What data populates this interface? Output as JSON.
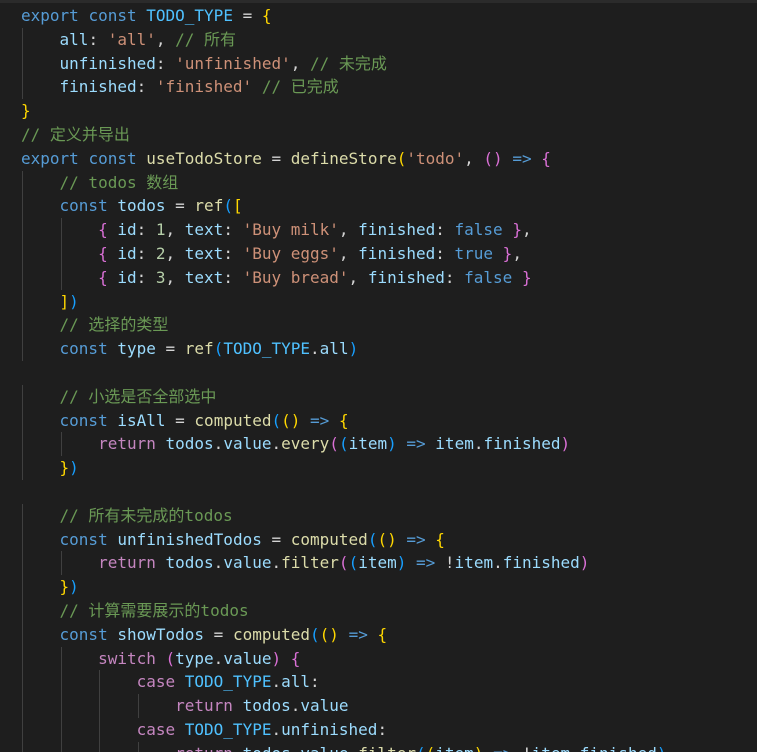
{
  "editor": {
    "language": "javascript",
    "lines": [
      [
        [
          "k",
          "export"
        ],
        [
          "op",
          " "
        ],
        [
          "k",
          "const"
        ],
        [
          "op",
          " "
        ],
        [
          "n",
          "TODO_TYPE"
        ],
        [
          "op",
          " = "
        ],
        [
          "b1",
          "{"
        ]
      ],
      [
        [
          "op",
          "    "
        ],
        [
          "v",
          "all"
        ],
        [
          "op",
          ": "
        ],
        [
          "s",
          "'all'"
        ],
        [
          "op",
          ", "
        ],
        [
          "cm",
          "// 所有"
        ]
      ],
      [
        [
          "op",
          "    "
        ],
        [
          "v",
          "unfinished"
        ],
        [
          "op",
          ": "
        ],
        [
          "s",
          "'unfinished'"
        ],
        [
          "op",
          ", "
        ],
        [
          "cm",
          "// 未完成"
        ]
      ],
      [
        [
          "op",
          "    "
        ],
        [
          "v",
          "finished"
        ],
        [
          "op",
          ": "
        ],
        [
          "s",
          "'finished'"
        ],
        [
          "op",
          " "
        ],
        [
          "cm",
          "// 已完成"
        ]
      ],
      [
        [
          "b1",
          "}"
        ]
      ],
      [
        [
          "cm",
          "// 定义并导出"
        ]
      ],
      [
        [
          "k",
          "export"
        ],
        [
          "op",
          " "
        ],
        [
          "k",
          "const"
        ],
        [
          "op",
          " "
        ],
        [
          "f",
          "useTodoStore"
        ],
        [
          "op",
          " = "
        ],
        [
          "f",
          "defineStore"
        ],
        [
          "b1",
          "("
        ],
        [
          "s",
          "'todo'"
        ],
        [
          "op",
          ", "
        ],
        [
          "b2",
          "()"
        ],
        [
          "op",
          " "
        ],
        [
          "k",
          "=>"
        ],
        [
          "op",
          " "
        ],
        [
          "b2",
          "{"
        ]
      ],
      [
        [
          "op",
          "    "
        ],
        [
          "cm",
          "// todos 数组"
        ]
      ],
      [
        [
          "op",
          "    "
        ],
        [
          "k",
          "const"
        ],
        [
          "op",
          " "
        ],
        [
          "v",
          "todos"
        ],
        [
          "op",
          " = "
        ],
        [
          "f",
          "ref"
        ],
        [
          "b3",
          "("
        ],
        [
          "b1",
          "["
        ]
      ],
      [
        [
          "op",
          "        "
        ],
        [
          "b2",
          "{"
        ],
        [
          "op",
          " "
        ],
        [
          "v",
          "id"
        ],
        [
          "op",
          ": "
        ],
        [
          "num",
          "1"
        ],
        [
          "op",
          ", "
        ],
        [
          "v",
          "text"
        ],
        [
          "op",
          ": "
        ],
        [
          "s",
          "'Buy milk'"
        ],
        [
          "op",
          ", "
        ],
        [
          "v",
          "finished"
        ],
        [
          "op",
          ": "
        ],
        [
          "k",
          "false"
        ],
        [
          "op",
          " "
        ],
        [
          "b2",
          "}"
        ],
        [
          "op",
          ","
        ]
      ],
      [
        [
          "op",
          "        "
        ],
        [
          "b2",
          "{"
        ],
        [
          "op",
          " "
        ],
        [
          "v",
          "id"
        ],
        [
          "op",
          ": "
        ],
        [
          "num",
          "2"
        ],
        [
          "op",
          ", "
        ],
        [
          "v",
          "text"
        ],
        [
          "op",
          ": "
        ],
        [
          "s",
          "'Buy eggs'"
        ],
        [
          "op",
          ", "
        ],
        [
          "v",
          "finished"
        ],
        [
          "op",
          ": "
        ],
        [
          "k",
          "true"
        ],
        [
          "op",
          " "
        ],
        [
          "b2",
          "}"
        ],
        [
          "op",
          ","
        ]
      ],
      [
        [
          "op",
          "        "
        ],
        [
          "b2",
          "{"
        ],
        [
          "op",
          " "
        ],
        [
          "v",
          "id"
        ],
        [
          "op",
          ": "
        ],
        [
          "num",
          "3"
        ],
        [
          "op",
          ", "
        ],
        [
          "v",
          "text"
        ],
        [
          "op",
          ": "
        ],
        [
          "s",
          "'Buy bread'"
        ],
        [
          "op",
          ", "
        ],
        [
          "v",
          "finished"
        ],
        [
          "op",
          ": "
        ],
        [
          "k",
          "false"
        ],
        [
          "op",
          " "
        ],
        [
          "b2",
          "}"
        ]
      ],
      [
        [
          "op",
          "    "
        ],
        [
          "b1",
          "]"
        ],
        [
          "b3",
          ")"
        ]
      ],
      [
        [
          "op",
          "    "
        ],
        [
          "cm",
          "// 选择的类型"
        ]
      ],
      [
        [
          "op",
          "    "
        ],
        [
          "k",
          "const"
        ],
        [
          "op",
          " "
        ],
        [
          "v",
          "type"
        ],
        [
          "op",
          " = "
        ],
        [
          "f",
          "ref"
        ],
        [
          "b3",
          "("
        ],
        [
          "n",
          "TODO_TYPE"
        ],
        [
          "op",
          "."
        ],
        [
          "v",
          "all"
        ],
        [
          "b3",
          ")"
        ]
      ],
      [],
      [
        [
          "op",
          "    "
        ],
        [
          "cm",
          "// 小选是否全部选中"
        ]
      ],
      [
        [
          "op",
          "    "
        ],
        [
          "k",
          "const"
        ],
        [
          "op",
          " "
        ],
        [
          "v",
          "isAll"
        ],
        [
          "op",
          " = "
        ],
        [
          "f",
          "computed"
        ],
        [
          "b3",
          "("
        ],
        [
          "b1",
          "()"
        ],
        [
          "op",
          " "
        ],
        [
          "k",
          "=>"
        ],
        [
          "op",
          " "
        ],
        [
          "b1",
          "{"
        ]
      ],
      [
        [
          "op",
          "        "
        ],
        [
          "c",
          "return"
        ],
        [
          "op",
          " "
        ],
        [
          "v",
          "todos"
        ],
        [
          "op",
          "."
        ],
        [
          "v",
          "value"
        ],
        [
          "op",
          "."
        ],
        [
          "f",
          "every"
        ],
        [
          "b2",
          "("
        ],
        [
          "b3",
          "("
        ],
        [
          "v",
          "item"
        ],
        [
          "b3",
          ")"
        ],
        [
          "op",
          " "
        ],
        [
          "k",
          "=>"
        ],
        [
          "op",
          " "
        ],
        [
          "v",
          "item"
        ],
        [
          "op",
          "."
        ],
        [
          "v",
          "finished"
        ],
        [
          "b2",
          ")"
        ]
      ],
      [
        [
          "op",
          "    "
        ],
        [
          "b1",
          "}"
        ],
        [
          "b3",
          ")"
        ]
      ],
      [],
      [
        [
          "op",
          "    "
        ],
        [
          "cm",
          "// 所有未完成的todos"
        ]
      ],
      [
        [
          "op",
          "    "
        ],
        [
          "k",
          "const"
        ],
        [
          "op",
          " "
        ],
        [
          "v",
          "unfinishedTodos"
        ],
        [
          "op",
          " = "
        ],
        [
          "f",
          "computed"
        ],
        [
          "b3",
          "("
        ],
        [
          "b1",
          "()"
        ],
        [
          "op",
          " "
        ],
        [
          "k",
          "=>"
        ],
        [
          "op",
          " "
        ],
        [
          "b1",
          "{"
        ]
      ],
      [
        [
          "op",
          "        "
        ],
        [
          "c",
          "return"
        ],
        [
          "op",
          " "
        ],
        [
          "v",
          "todos"
        ],
        [
          "op",
          "."
        ],
        [
          "v",
          "value"
        ],
        [
          "op",
          "."
        ],
        [
          "f",
          "filter"
        ],
        [
          "b2",
          "("
        ],
        [
          "b3",
          "("
        ],
        [
          "v",
          "item"
        ],
        [
          "b3",
          ")"
        ],
        [
          "op",
          " "
        ],
        [
          "k",
          "=>"
        ],
        [
          "op",
          " !"
        ],
        [
          "v",
          "item"
        ],
        [
          "op",
          "."
        ],
        [
          "v",
          "finished"
        ],
        [
          "b2",
          ")"
        ]
      ],
      [
        [
          "op",
          "    "
        ],
        [
          "b1",
          "}"
        ],
        [
          "b3",
          ")"
        ]
      ],
      [
        [
          "op",
          "    "
        ],
        [
          "cm",
          "// 计算需要展示的todos"
        ]
      ],
      [
        [
          "op",
          "    "
        ],
        [
          "k",
          "const"
        ],
        [
          "op",
          " "
        ],
        [
          "v",
          "showTodos"
        ],
        [
          "op",
          " = "
        ],
        [
          "f",
          "computed"
        ],
        [
          "b3",
          "("
        ],
        [
          "b1",
          "()"
        ],
        [
          "op",
          " "
        ],
        [
          "k",
          "=>"
        ],
        [
          "op",
          " "
        ],
        [
          "b1",
          "{"
        ]
      ],
      [
        [
          "op",
          "        "
        ],
        [
          "c",
          "switch"
        ],
        [
          "op",
          " "
        ],
        [
          "b2",
          "("
        ],
        [
          "v",
          "type"
        ],
        [
          "op",
          "."
        ],
        [
          "v",
          "value"
        ],
        [
          "b2",
          ")"
        ],
        [
          "op",
          " "
        ],
        [
          "b2",
          "{"
        ]
      ],
      [
        [
          "op",
          "            "
        ],
        [
          "c",
          "case"
        ],
        [
          "op",
          " "
        ],
        [
          "n",
          "TODO_TYPE"
        ],
        [
          "op",
          "."
        ],
        [
          "v",
          "all"
        ],
        [
          "op",
          ":"
        ]
      ],
      [
        [
          "op",
          "                "
        ],
        [
          "c",
          "return"
        ],
        [
          "op",
          " "
        ],
        [
          "v",
          "todos"
        ],
        [
          "op",
          "."
        ],
        [
          "v",
          "value"
        ]
      ],
      [
        [
          "op",
          "            "
        ],
        [
          "c",
          "case"
        ],
        [
          "op",
          " "
        ],
        [
          "n",
          "TODO_TYPE"
        ],
        [
          "op",
          "."
        ],
        [
          "v",
          "unfinished"
        ],
        [
          "op",
          ":"
        ]
      ],
      [
        [
          "op",
          "                "
        ],
        [
          "c",
          "return"
        ],
        [
          "op",
          " "
        ],
        [
          "v",
          "todos"
        ],
        [
          "op",
          "."
        ],
        [
          "v",
          "value"
        ],
        [
          "op",
          "."
        ],
        [
          "f",
          "filter"
        ],
        [
          "b3",
          "("
        ],
        [
          "b1",
          "("
        ],
        [
          "v",
          "item"
        ],
        [
          "b1",
          ")"
        ],
        [
          "op",
          " "
        ],
        [
          "k",
          "=>"
        ],
        [
          "op",
          " !"
        ],
        [
          "v",
          "item"
        ],
        [
          "op",
          "."
        ],
        [
          "v",
          "finished"
        ],
        [
          "b3",
          ")"
        ]
      ]
    ]
  }
}
